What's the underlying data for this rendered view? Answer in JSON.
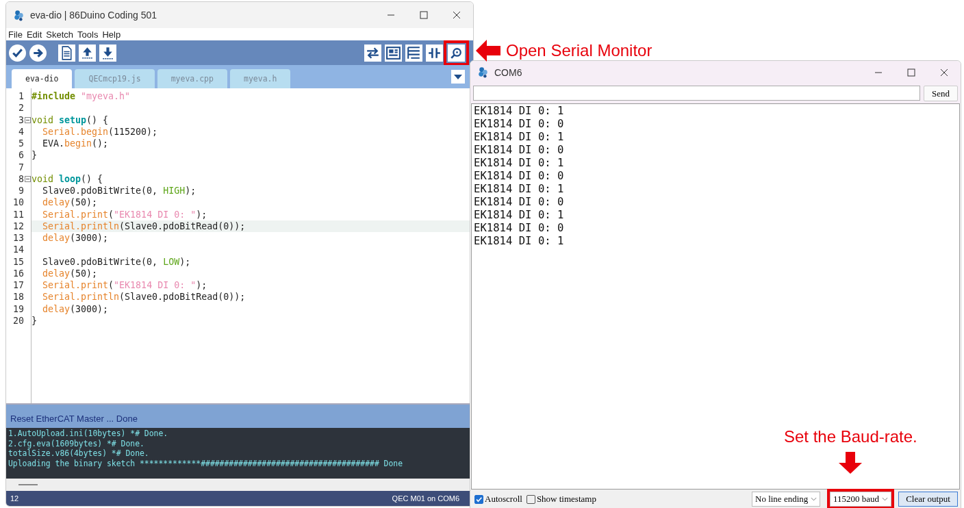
{
  "ide": {
    "window": {
      "title": "eva-dio | 86Duino Coding 501"
    },
    "menu": [
      "File",
      "Edit",
      "Sketch",
      "Tools",
      "Help"
    ],
    "toolbar": [
      {
        "kind": "verify",
        "highlighted": false
      },
      {
        "kind": "upload",
        "highlighted": false
      },
      {
        "kind": "new",
        "highlighted": false
      },
      {
        "kind": "open",
        "highlighted": false
      },
      {
        "kind": "save",
        "highlighted": false
      },
      {
        "kind": "transfer",
        "highlighted": false
      },
      {
        "kind": "board",
        "highlighted": false
      },
      {
        "kind": "config",
        "highlighted": false
      },
      {
        "kind": "plotter",
        "highlighted": false
      },
      {
        "kind": "monitor",
        "highlighted": true
      }
    ],
    "tabs": [
      {
        "label": "eva-dio",
        "selected": true
      },
      {
        "label": "QECmcp19.js",
        "selected": false
      },
      {
        "label": "myeva.cpp",
        "selected": false
      },
      {
        "label": "myeva.h",
        "selected": false
      }
    ],
    "code": [
      {
        "number": "1",
        "fold": false,
        "indented": false,
        "highlighted": false,
        "tokens": [
          {
            "text": "#include ",
            "kind": "directive"
          },
          {
            "text": "\"myeva.h\"",
            "kind": "string"
          }
        ]
      },
      {
        "number": "2",
        "fold": false,
        "highlighted": false
      },
      {
        "number": "3",
        "fold": true,
        "indented": false,
        "highlighted": false,
        "tokens": [
          {
            "text": "void ",
            "kind": "type"
          },
          {
            "text": "setup",
            "kind": "function"
          },
          {
            "text": "() {",
            "kind": "plain"
          }
        ]
      },
      {
        "number": "4",
        "fold": false,
        "indented": true,
        "highlighted": false,
        "tokens": [
          {
            "text": "Serial.begin",
            "kind": "method"
          },
          {
            "text": "(115200);",
            "kind": "plain"
          }
        ]
      },
      {
        "number": "5",
        "fold": false,
        "indented": true,
        "highlighted": false,
        "tokens": [
          {
            "text": "EVA.",
            "kind": "plain"
          },
          {
            "text": "begin",
            "kind": "method"
          },
          {
            "text": "();",
            "kind": "plain"
          }
        ]
      },
      {
        "number": "6",
        "fold": false,
        "indented": false,
        "highlighted": false,
        "tokens": [
          {
            "text": "}",
            "kind": "plain"
          }
        ]
      },
      {
        "number": "7",
        "fold": false,
        "highlighted": false
      },
      {
        "number": "8",
        "fold": true,
        "indented": false,
        "highlighted": false,
        "tokens": [
          {
            "text": "void ",
            "kind": "type"
          },
          {
            "text": "loop",
            "kind": "function"
          },
          {
            "text": "() {",
            "kind": "plain"
          }
        ]
      },
      {
        "number": "9",
        "fold": false,
        "indented": true,
        "highlighted": false,
        "tokens": [
          {
            "text": "Slave0.pdoBitWrite(0, ",
            "kind": "plain"
          },
          {
            "text": "HIGH",
            "kind": "constant"
          },
          {
            "text": ");",
            "kind": "plain"
          }
        ]
      },
      {
        "number": "10",
        "fold": false,
        "indented": true,
        "highlighted": false,
        "tokens": [
          {
            "text": "delay",
            "kind": "method"
          },
          {
            "text": "(50);",
            "kind": "plain"
          }
        ]
      },
      {
        "number": "11",
        "fold": false,
        "indented": true,
        "highlighted": false,
        "tokens": [
          {
            "text": "Serial.print",
            "kind": "method"
          },
          {
            "text": "(",
            "kind": "plain"
          },
          {
            "text": "\"EK1814 DI 0: \"",
            "kind": "string"
          },
          {
            "text": ");",
            "kind": "plain"
          }
        ]
      },
      {
        "number": "12",
        "fold": false,
        "indented": true,
        "highlighted": true,
        "tokens": [
          {
            "text": "Serial.println",
            "kind": "method"
          },
          {
            "text": "(Slave0.pdoBitRead(0));",
            "kind": "plain"
          }
        ]
      },
      {
        "number": "13",
        "fold": false,
        "indented": true,
        "highlighted": false,
        "tokens": [
          {
            "text": "delay",
            "kind": "method"
          },
          {
            "text": "(3000);",
            "kind": "plain"
          }
        ]
      },
      {
        "number": "14",
        "fold": false,
        "highlighted": false
      },
      {
        "number": "15",
        "fold": false,
        "indented": true,
        "highlighted": false,
        "tokens": [
          {
            "text": "Slave0.pdoBitWrite(0, ",
            "kind": "plain"
          },
          {
            "text": "LOW",
            "kind": "constant"
          },
          {
            "text": ");",
            "kind": "plain"
          }
        ]
      },
      {
        "number": "16",
        "fold": false,
        "indented": true,
        "highlighted": false,
        "tokens": [
          {
            "text": "delay",
            "kind": "method"
          },
          {
            "text": "(50);",
            "kind": "plain"
          }
        ]
      },
      {
        "number": "17",
        "fold": false,
        "indented": true,
        "highlighted": false,
        "tokens": [
          {
            "text": "Serial.print",
            "kind": "method"
          },
          {
            "text": "(",
            "kind": "plain"
          },
          {
            "text": "\"EK1814 DI 0: \"",
            "kind": "string"
          },
          {
            "text": ");",
            "kind": "plain"
          }
        ]
      },
      {
        "number": "18",
        "fold": false,
        "indented": true,
        "highlighted": false,
        "tokens": [
          {
            "text": "Serial.println",
            "kind": "method"
          },
          {
            "text": "(Slave0.pdoBitRead(0));",
            "kind": "plain"
          }
        ]
      },
      {
        "number": "19",
        "fold": false,
        "indented": true,
        "highlighted": false,
        "tokens": [
          {
            "text": "delay",
            "kind": "method"
          },
          {
            "text": "(3000);",
            "kind": "plain"
          }
        ]
      },
      {
        "number": "20",
        "fold": false,
        "indented": false,
        "highlighted": false,
        "tokens": [
          {
            "text": "}",
            "kind": "plain"
          }
        ]
      }
    ],
    "message": "Reset EtherCAT Master ... Done",
    "console": [
      "1.AutoUpload.ini(10bytes) *# Done.",
      "2.cfg.eva(1609bytes) *# Done.",
      "totalSize.v86(4bytes) *# Done.",
      "Uploading the binary sketch *************###################################### Done"
    ],
    "status_bar": {
      "line": "12",
      "board": "QEC M01 on COM6"
    }
  },
  "serial_monitor": {
    "window": {
      "title": "COM6"
    },
    "send_button": "Send",
    "output": [
      "EK1814 DI 0: 1",
      "EK1814 DI 0: 0",
      "EK1814 DI 0: 1",
      "EK1814 DI 0: 0",
      "EK1814 DI 0: 1",
      "EK1814 DI 0: 0",
      "EK1814 DI 0: 1",
      "EK1814 DI 0: 0",
      "EK1814 DI 0: 1",
      "EK1814 DI 0: 0",
      "EK1814 DI 0: 1"
    ],
    "autoscroll": {
      "label": "Autoscroll",
      "checked": true
    },
    "timestamp": {
      "label": "Show timestamp",
      "checked": false
    },
    "line_ending": {
      "value": "No line ending",
      "highlighted": false
    },
    "baud": {
      "value": "115200 baud",
      "highlighted": true
    },
    "clear_button": "Clear output"
  },
  "annotations": [
    {
      "text": "Open Serial Monitor",
      "kind": "left"
    },
    {
      "text": "Set the Baud-rate.",
      "kind": "down"
    }
  ]
}
